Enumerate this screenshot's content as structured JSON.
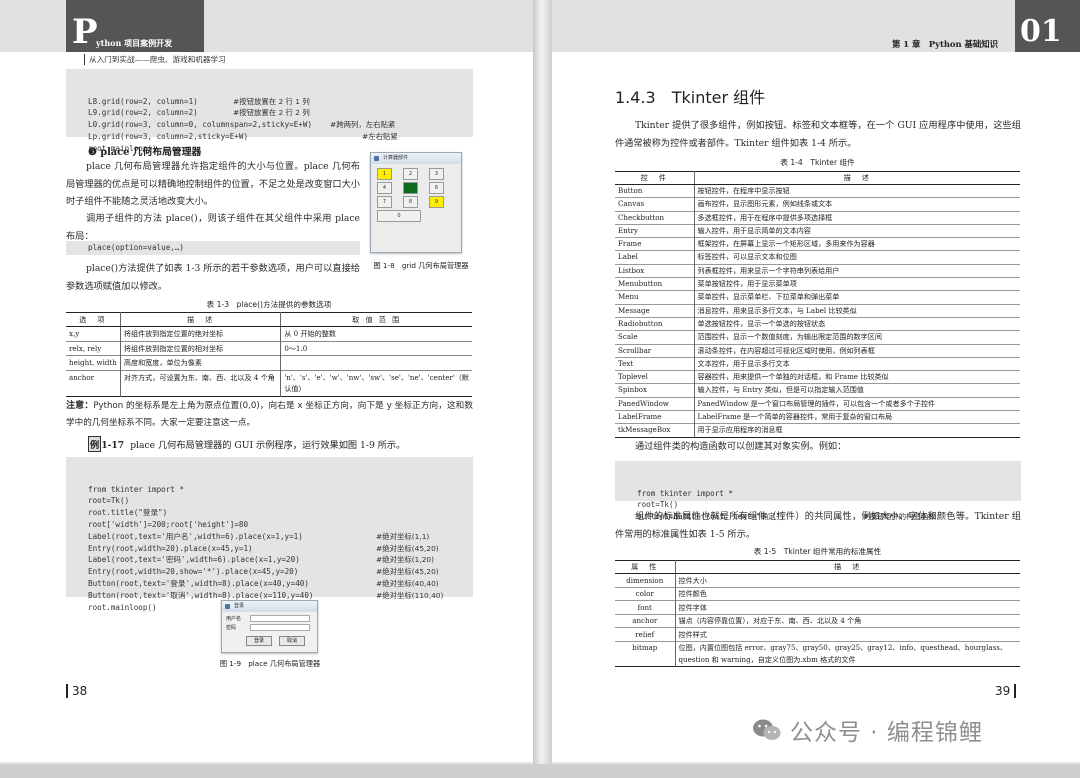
{
  "left_page": {
    "header_big_letter": "P",
    "header_series": "ython 项目案例开发",
    "header_subtitle": "从入门到实战——爬虫、游戏和机器学习",
    "top_code": [
      {
        "code": "L8.grid(row=2, column=1)",
        "comment": "#按钮放置在 2 行 1 列"
      },
      {
        "code": "L9.grid(row=2, column=2)",
        "comment": "#按钮放置在 2 行 2 列"
      },
      {
        "code": "L0.grid(row=3, column=0, columnspan=2,sticky=E+W)",
        "comment": "#跨两列，左右贴紧"
      },
      {
        "code": "Lp.grid(row=3, column=2,sticky=E+W)",
        "comment": "#左右贴紧"
      },
      {
        "code": "root.mainloop()",
        "comment": ""
      }
    ],
    "section3_num": "❸",
    "section3_title": "place 几何布局管理器",
    "section3_para1": "place 几何布局管理器允许指定组件的大小与位置。place 几何布局管理器的优点是可以精确地控制组件的位置，不足之处是改变窗口大小时子组件不能随之灵活地改变大小。",
    "section3_para2": "调用子组件的方法 place()，则该子组件在其父组件中采用 place 布局：",
    "place_code": "place(option=value,…)",
    "section3_para3": "place()方法提供了如表 1-3 所示的若干参数选项，用户可以直接给参数选项赋值加以修改。",
    "fig18_window_title": "计算器部件",
    "fig18_cells": [
      "1",
      "2",
      "3",
      "4",
      "5",
      "6",
      "7",
      "8",
      "9",
      "0"
    ],
    "fig18_caption": "图 1-8　grid 几何布局管理器",
    "table13_caption": "表 1-3　place()方法提供的参数选项",
    "table13_headers": [
      "选　项",
      "描　述",
      "取 值 范 围"
    ],
    "table13_rows": [
      [
        "x,y",
        "将组件放到指定位置的绝对坐标",
        "从 0 开始的整数"
      ],
      [
        "relx, rely",
        "将组件放到指定位置的相对坐标",
        "0～1.0"
      ],
      [
        "height, width",
        "高度和宽度，单位为像素",
        ""
      ],
      [
        "anchor",
        "对齐方式，可设置为东、南、西、北以及 4 个角",
        "'n'、's'、'e'、'w'、'nw'、'sw'、'se'、'ne'、'center'（默认值）"
      ]
    ],
    "note_label": "注意：",
    "note_text": "Python 的坐标系是左上角为原点位置(0,0)，向右是 x 坐标正方向，向下是 y 坐标正方向，这和数学中的几何坐标系不同。大家一定要注意这一点。",
    "example_tag": "例",
    "example_num": "1-17",
    "example_text": "place 几何布局管理器的 GUI 示例程序，运行效果如图 1-9 所示。",
    "example_code": [
      {
        "code": "from tkinter import *",
        "comment": ""
      },
      {
        "code": "root=Tk()",
        "comment": ""
      },
      {
        "code": "root.title(\"登录\")",
        "comment": ""
      },
      {
        "code": "root['width']=200;root['height']=80",
        "comment": ""
      },
      {
        "code": "Label(root,text='用户名',width=6).place(x=1,y=1)",
        "comment": "#绝对坐标(1,1)"
      },
      {
        "code": "Entry(root,width=20).place(x=45,y=1)",
        "comment": "#绝对坐标(45,20)"
      },
      {
        "code": "Label(root,text='密码',width=6).place(x=1,y=20)",
        "comment": "#绝对坐标(1,20)"
      },
      {
        "code": "Entry(root,width=20,show='*').place(x=45,y=20)",
        "comment": "#绝对坐标(45,20)"
      },
      {
        "code": "Button(root,text='登录',width=8).place(x=40,y=40)",
        "comment": "#绝对坐标(40,40)"
      },
      {
        "code": "Button(root,text='取消',width=8).place(x=110,y=40)",
        "comment": "#绝对坐标(110,40)"
      },
      {
        "code": "root.mainloop()",
        "comment": ""
      }
    ],
    "fig19_window_title": "登录",
    "fig19_label_user": "用户名",
    "fig19_label_pwd": "密码",
    "fig19_btn_login": "登录",
    "fig19_btn_cancel": "取消",
    "fig19_caption": "图 1-9　place 几何布局管理器",
    "page_number": "38"
  },
  "right_page": {
    "header_chapter": "第 1 章　Python 基础知识",
    "header_num": "01",
    "section_title": "1.4.3　Tkinter 组件",
    "intro": "Tkinter 提供了很多组件，例如按钮、标签和文本框等，在一个 GUI 应用程序中使用，这些组件通常被称为控件或者部件。Tkinter 组件如表 1-4 所示。",
    "table14_caption": "表 1-4　Tkinter 组件",
    "table14_headers": [
      "控　件",
      "描　述"
    ],
    "table14_rows": [
      [
        "Button",
        "按钮控件，在程序中显示按钮"
      ],
      [
        "Canvas",
        "画布控件，显示图形元素，例如线条或文本"
      ],
      [
        "Checkbutton",
        "多选框控件，用于在程序中提供多项选择框"
      ],
      [
        "Entry",
        "输入控件，用于显示简单的文本内容"
      ],
      [
        "Frame",
        "框架控件，在屏幕上显示一个矩形区域，多用来作为容器"
      ],
      [
        "Label",
        "标签控件，可以显示文本和位图"
      ],
      [
        "Listbox",
        "列表框控件，用来显示一个字符串列表给用户"
      ],
      [
        "Menubutton",
        "菜单按钮控件，用于显示菜单项"
      ],
      [
        "Menu",
        "菜单控件，显示菜单栏、下拉菜单和弹出菜单"
      ],
      [
        "Message",
        "消息控件，用来显示多行文本，与 Label 比较类似"
      ],
      [
        "Radiobutton",
        "单选按钮控件，显示一个单选的按钮状态"
      ],
      [
        "Scale",
        "范围控件，显示一个数值刻度，为输出限定范围的数字区间"
      ],
      [
        "Scrollbar",
        "滚动条控件，在内容超过可视化区域时使用，例如列表框"
      ],
      [
        "Text",
        "文本控件，用于显示多行文本"
      ],
      [
        "Toplevel",
        "容器控件，用来提供一个单独的对话框，和 Frame 比较类似"
      ],
      [
        "Spinbox",
        "输入控件，与 Entry 类似，但是可以指定输入范围值"
      ],
      [
        "PanedWindow",
        "PanedWindow 是一个窗口布局管理的插件，可以包含一个或者多个子控件"
      ],
      [
        "LabelFrame",
        "LabelFrame 是一个简单的容器控件，常用于复杂的窗口布局"
      ],
      [
        "tkMessageBox",
        "用于显示应用程序的消息框"
      ]
    ],
    "para2": "通过组件类的构造函数可以创建其对象实例。例如：",
    "code2": [
      {
        "code": "from tkinter import *",
        "comment": ""
      },
      {
        "code": "root=Tk()",
        "comment": ""
      },
      {
        "code": "button1=Button(root, text=\"确定\")",
        "comment": "#按钮组件的构造函数"
      }
    ],
    "para3": "组件的标准属性也就是所有组件（控件）的共同属性，例如大小、字体和颜色等。Tkinter 组件常用的标准属性如表 1-5 所示。",
    "table15_caption": "表 1-5　Tkinter 组件常用的标准属性",
    "table15_headers": [
      "属　性",
      "描　述"
    ],
    "table15_rows": [
      [
        "dimension",
        "控件大小"
      ],
      [
        "color",
        "控件颜色"
      ],
      [
        "font",
        "控件字体"
      ],
      [
        "anchor",
        "锚点（内容停靠位置），对应于东、南、西、北以及 4 个角"
      ],
      [
        "relief",
        "控件样式"
      ],
      [
        "bitmap",
        "位图，内置位图包括 error、gray75、gray50、gray25、gray12、info、questhead、hourglass、question 和 warning，自定义位图为.xbm 格式的文件"
      ]
    ],
    "page_number": "39"
  },
  "watermark": "公众号 · 编程锦鲤"
}
